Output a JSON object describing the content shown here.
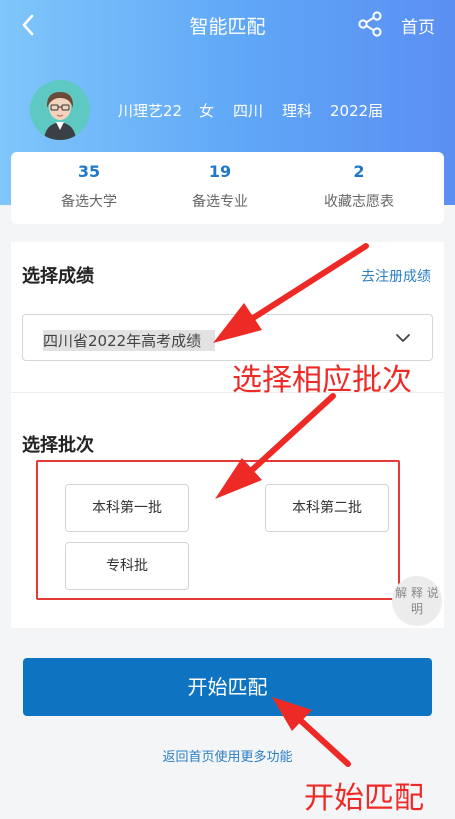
{
  "header": {
    "title": "智能匹配",
    "home_label": "首页",
    "icons": [
      "back-icon",
      "share-icon"
    ]
  },
  "profile": {
    "username": "川理艺22",
    "gender": "女",
    "province": "四川",
    "track": "理科",
    "year": "2022届"
  },
  "stats": [
    {
      "value": "35",
      "label": "备选大学"
    },
    {
      "value": "19",
      "label": "备选专业"
    },
    {
      "value": "2",
      "label": "收藏志愿表"
    }
  ],
  "score_section": {
    "title": "选择成绩",
    "register_link": "去注册成绩",
    "selected_score": "四川省2022年高考成绩"
  },
  "batch_section": {
    "title": "选择批次",
    "options": [
      "本科第一批",
      "本科第二批",
      "专科批"
    ]
  },
  "explain_label": "解 释 说 明",
  "start_button": "开始匹配",
  "more_link": "返回首页使用更多功能",
  "annotations": {
    "batch_note": "选择相应批次",
    "start_note": "开始匹配"
  },
  "colors": {
    "primary": "#0e74c2",
    "link": "#2a7fc6",
    "annotation": "#ee2a26"
  }
}
